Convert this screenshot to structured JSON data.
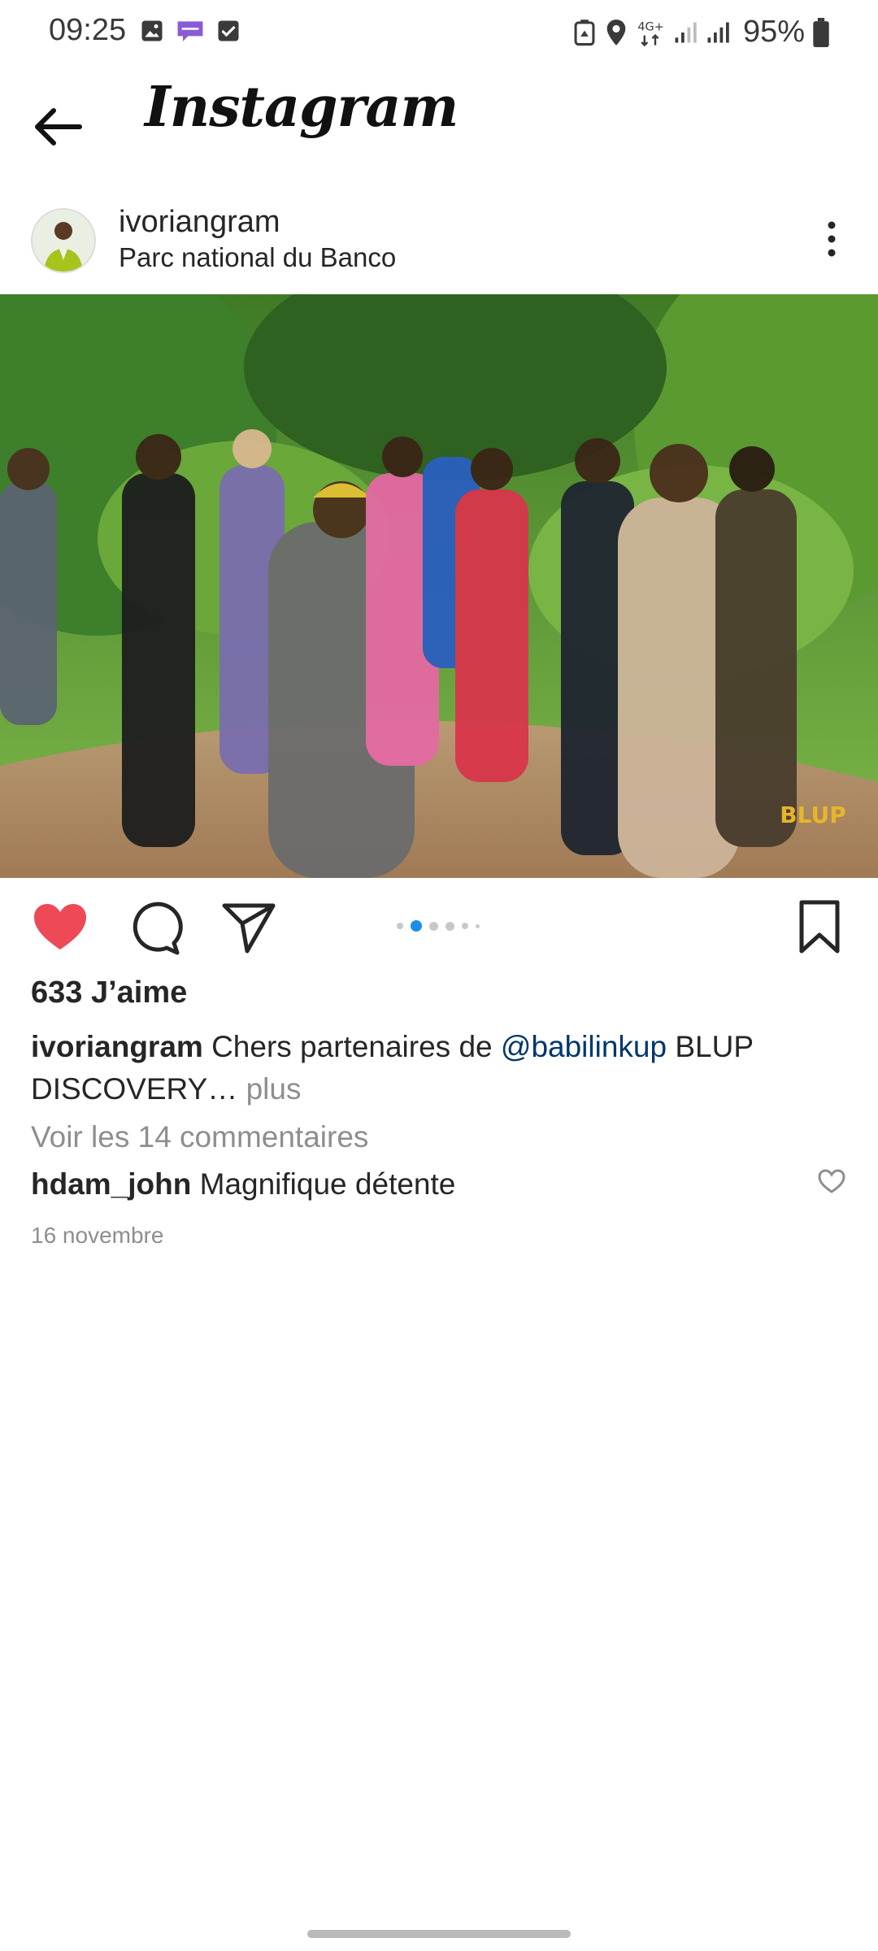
{
  "status_bar": {
    "time": "09:25",
    "network": "4G+",
    "battery": "95%",
    "notification_icons": [
      "image-icon",
      "chat-icon",
      "check-box-icon"
    ],
    "system_icons": [
      "recycle-icon",
      "location-icon",
      "network-4g-icon",
      "signal-icon",
      "signal-icon",
      "battery-icon"
    ]
  },
  "header": {
    "back_icon": "arrow-left-icon",
    "brand": "Instagram"
  },
  "post": {
    "username": "ivoriangram",
    "location": "Parc national du Banco",
    "more_icon": "more-vertical-icon",
    "image_alt": "group-outdoor-photo",
    "carousel": {
      "count": 6,
      "active_index": 1
    },
    "liked": true,
    "like_color": "#ed4956",
    "accent_color": "#1a8fe6",
    "likes_text": "633 J’aime",
    "caption": {
      "username": "ivoriangram",
      "text_before": "Chers partenaires de",
      "mention": "@babilinkup",
      "text_after": "BLUP",
      "line2": "DISCOVERY…",
      "more": "plus"
    },
    "view_comments": "Voir les 14 commentaires",
    "comment": {
      "username": "hdam_john",
      "text": "Magnifique détente"
    },
    "date": "16 novembre"
  }
}
